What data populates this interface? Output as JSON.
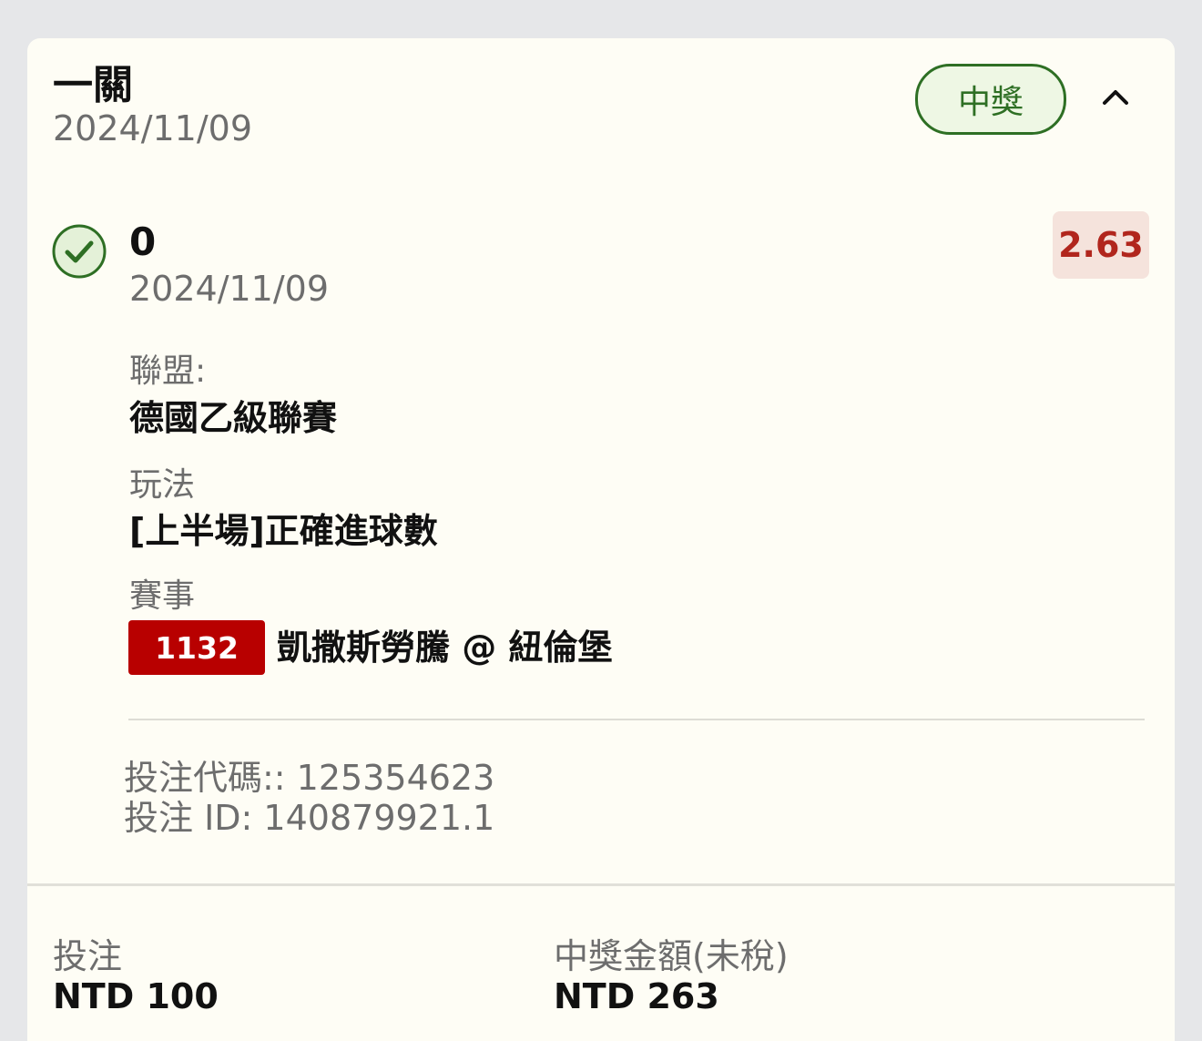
{
  "bet": {
    "title": "一關",
    "date": "2024/11/09",
    "status_label": "中獎",
    "collapse_icon": "chevron-up-icon"
  },
  "selection": {
    "result_icon": "check-circle-icon",
    "score": "0",
    "date": "2024/11/09",
    "odds": "2.63",
    "league_label": "聯盟:",
    "league": "德國乙級聯賽",
    "market_label": "玩法",
    "market": "[上半場]正確進球數",
    "event_label": "賽事",
    "event_id": "1132",
    "event_name": "凱撒斯勞騰 @ 紐倫堡"
  },
  "meta": {
    "bet_code": "投注代碼:: 125354623",
    "bet_id": "投注 ID: 140879921.1"
  },
  "footer": {
    "stake_label": "投注",
    "stake_value": "NTD 100",
    "payout_label": "中獎金額(未稅)",
    "payout_value": "NTD 263"
  },
  "colors": {
    "success": "#2e6f24",
    "odds": "#b1261d",
    "event_badge": "#b80000",
    "card_bg": "#fefdf5"
  }
}
